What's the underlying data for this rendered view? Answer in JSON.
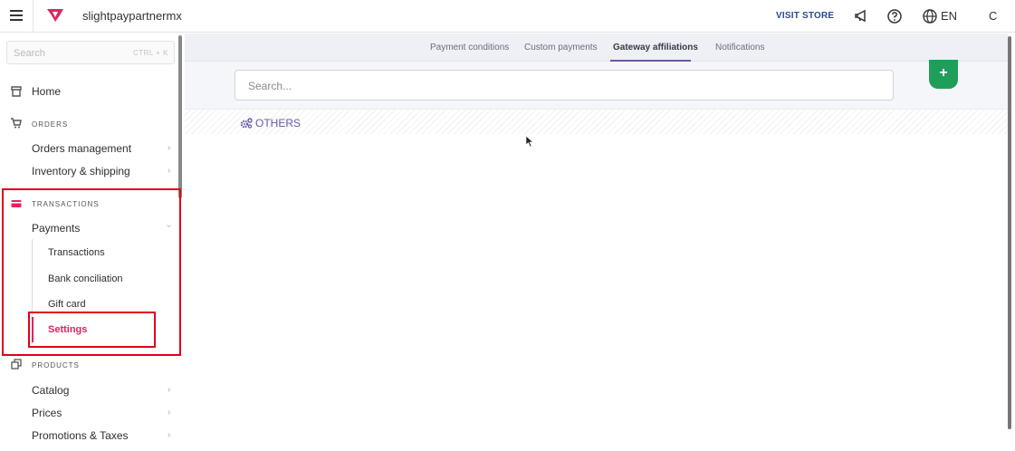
{
  "header": {
    "store_name": "slightpaypartnermx",
    "visit_store": "VISIT STORE",
    "language": "EN",
    "user_initial": "C",
    "brand_color": "#e0245e"
  },
  "sidebar": {
    "search_placeholder": "Search",
    "search_shortcut": "CTRL + K",
    "home": "Home",
    "orders_section": "ORDERS",
    "orders_management": "Orders management",
    "inventory_shipping": "Inventory & shipping",
    "transactions_section": "TRANSACTIONS",
    "payments": "Payments",
    "transactions": "Transactions",
    "bank_conciliation": "Bank conciliation",
    "gift_card": "Gift card",
    "settings": "Settings",
    "products_section": "PRODUCTS",
    "catalog": "Catalog",
    "prices": "Prices",
    "promotions_taxes": "Promotions & Taxes"
  },
  "tabs": {
    "payment_conditions": "Payment conditions",
    "custom_payments": "Custom payments",
    "gateway_affiliations": "Gateway affiliations",
    "notifications": "Notifications",
    "active": "Gateway affiliations"
  },
  "main": {
    "search_placeholder": "Search...",
    "add_button": "+",
    "others_label": "OTHERS"
  }
}
